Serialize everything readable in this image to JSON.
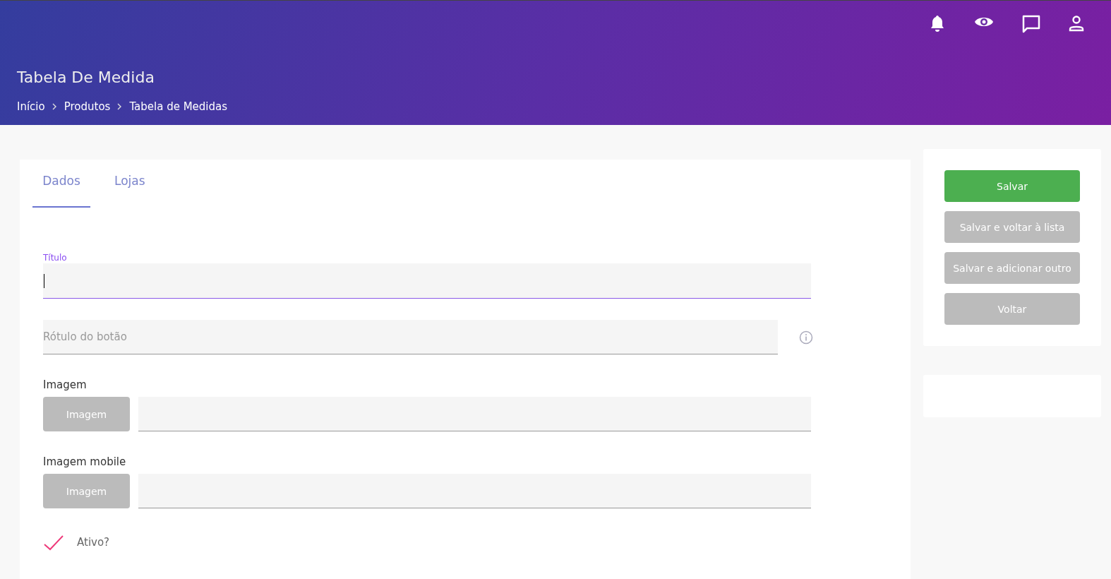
{
  "header": {
    "title": "Tabela De Medida",
    "breadcrumbs": [
      "Início",
      "Produtos",
      "Tabela de Medidas"
    ]
  },
  "tabs": [
    {
      "label": "Dados",
      "selected": true
    },
    {
      "label": "Lojas",
      "selected": false
    }
  ],
  "form": {
    "title_field": {
      "label": "Título",
      "focused": true
    },
    "button_label_field": {
      "placeholder": "Rótulo do botão"
    },
    "uploads": [
      {
        "label": "Imagem",
        "button": "Imagem"
      },
      {
        "label": "Imagem mobile",
        "button": "Imagem"
      }
    ],
    "active": {
      "label": "Ativo?",
      "checked": true
    }
  },
  "actions": [
    {
      "label": "Salvar",
      "kind": "primary"
    },
    {
      "label": "Salvar e voltar à lista",
      "kind": "secondary"
    },
    {
      "label": "Salvar e adicionar outro",
      "kind": "secondary"
    },
    {
      "label": "Voltar",
      "kind": "secondary"
    }
  ]
}
